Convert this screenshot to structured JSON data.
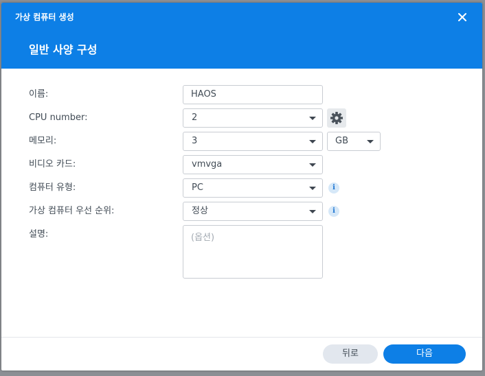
{
  "window": {
    "title": "가상 컴퓨터 생성"
  },
  "step": {
    "title": "일반 사양 구성"
  },
  "form": {
    "name": {
      "label": "이름:",
      "value": "HAOS"
    },
    "cpu": {
      "label": "CPU number:",
      "value": "2",
      "settings_icon": "gear-icon"
    },
    "memory": {
      "label": "메모리:",
      "value": "3",
      "unit": "GB"
    },
    "video": {
      "label": "비디오 카드:",
      "value": "vmvga"
    },
    "machine_type": {
      "label": "컴퓨터 유형:",
      "value": "PC",
      "info_icon": "info-icon",
      "info_glyph": "i"
    },
    "priority": {
      "label": "가상 컴퓨터 우선 순위:",
      "value": "정상",
      "info_icon": "info-icon",
      "info_glyph": "i"
    },
    "description": {
      "label": "설명:",
      "placeholder": "(옵션)"
    }
  },
  "footer": {
    "back_label": "뒤로",
    "next_label": "다음"
  },
  "colors": {
    "accent": "#0d7fe6",
    "back_button": "#e2e7ee",
    "text": "#414b55"
  }
}
